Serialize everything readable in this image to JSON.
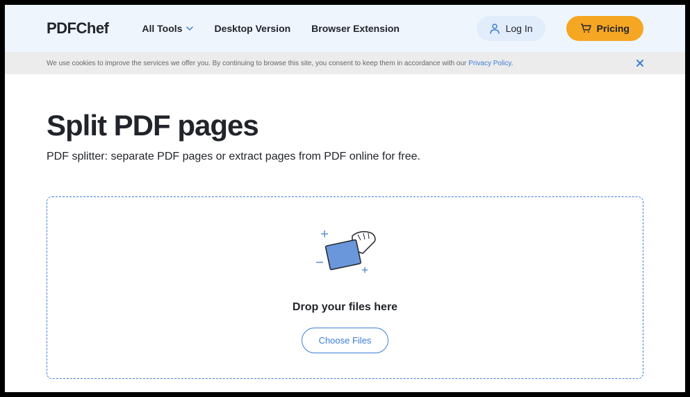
{
  "header": {
    "logo": "PDFChef",
    "nav": {
      "all_tools": "All Tools",
      "desktop": "Desktop Version",
      "extension": "Browser Extension"
    },
    "login": "Log In",
    "pricing": "Pricing"
  },
  "cookie": {
    "text": "We use cookies to improve the services we offer you. By continuing to browse this site, you consent to keep them in accordance with our ",
    "link": "Privacy Policy",
    "period": "."
  },
  "main": {
    "title": "Split PDF pages",
    "subtitle": "PDF splitter: separate PDF pages or extract pages from PDF online for free.",
    "drop_text": "Drop your files here",
    "choose_files": "Choose Files"
  }
}
